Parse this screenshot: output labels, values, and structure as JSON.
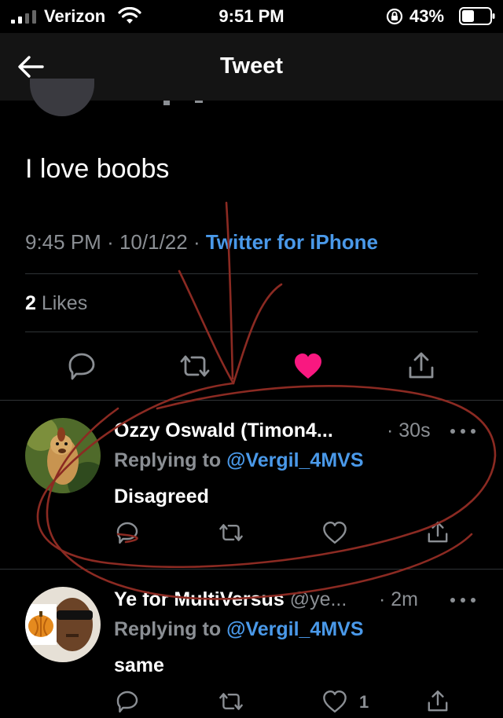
{
  "status_bar": {
    "carrier": "Verizon",
    "time": "9:51 PM",
    "battery_percent": "43%",
    "battery_level": 0.43
  },
  "nav": {
    "title": "Tweet",
    "back_icon": "arrow-left-icon"
  },
  "tweet": {
    "text": "I love boobs",
    "time": "9:45 PM",
    "date": "10/1/22",
    "separator": "·",
    "source": "Twitter for iPhone",
    "likes_count": "2",
    "likes_label": " Likes",
    "liked": true,
    "like_color": "#f91880",
    "actions": [
      "reply-icon",
      "retweet-icon",
      "heart-filled-icon",
      "share-icon"
    ]
  },
  "replies": [
    {
      "name": "Ozzy Oswald (Timon4...",
      "handle": "",
      "time": "· 30s",
      "replying_prefix": "Replying to ",
      "replying_to": "@Vergil_4MVS",
      "text": "Disagreed",
      "like_count": ""
    },
    {
      "name": "Ye for MultiVersus",
      "handle": " @ye... ",
      "time": "· 2m",
      "replying_prefix": "Replying to ",
      "replying_to": "@Vergil_4MVS",
      "text": "same",
      "like_count": "1"
    }
  ],
  "colors": {
    "background": "#000000",
    "link": "#4a99e9",
    "muted": "#8b8f94",
    "annotation": "#8b2a22"
  }
}
